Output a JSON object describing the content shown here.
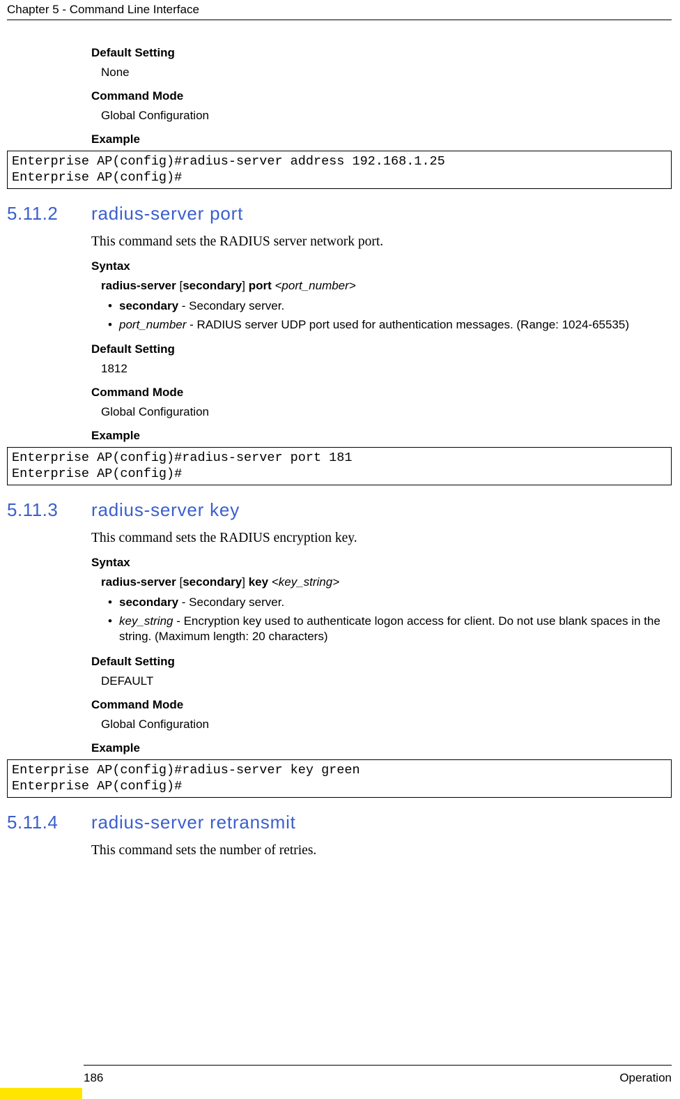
{
  "header": {
    "chapter": "Chapter 5 - Command Line Interface"
  },
  "section_5_11_1_tail": {
    "default_setting_label": "Default Setting",
    "default_setting_value": "None",
    "command_mode_label": "Command Mode",
    "command_mode_value": "Global Configuration",
    "example_label": "Example",
    "code_line1": "Enterprise AP(config)#radius-server address 192.168.1.25",
    "code_line2": "Enterprise AP(config)#"
  },
  "section_5_11_2": {
    "num": "5.11.2",
    "title": "radius-server port",
    "desc": "This command sets the RADIUS server network port.",
    "syntax_label": "Syntax",
    "syntax_cmd_b1": "radius-server",
    "syntax_open": " [",
    "syntax_cmd_b2": "secondary",
    "syntax_close": "] ",
    "syntax_cmd_b3": "port",
    "syntax_space": " ",
    "syntax_arg_open": "<",
    "syntax_arg": "port_number",
    "syntax_arg_close": ">",
    "param1_b": "secondary",
    "param1_rest": " - Secondary server.",
    "param2_i": "port_number",
    "param2_rest": " - RADIUS server UDP port used for authentication messages. (Range: 1024-65535)",
    "default_setting_label": "Default Setting",
    "default_setting_value": "1812",
    "command_mode_label": "Command Mode",
    "command_mode_value": "Global Configuration",
    "example_label": "Example",
    "code_line1": "Enterprise AP(config)#radius-server port 181",
    "code_line2": "Enterprise AP(config)#"
  },
  "section_5_11_3": {
    "num": "5.11.3",
    "title": "radius-server key",
    "desc": "This command sets the RADIUS encryption key.",
    "syntax_label": "Syntax",
    "syntax_cmd_b1": "radius-server",
    "syntax_open": " [",
    "syntax_cmd_b2": "secondary",
    "syntax_close": "] ",
    "syntax_cmd_b3": "key",
    "syntax_space": " ",
    "syntax_arg_open": "<",
    "syntax_arg": "key_string",
    "syntax_arg_close": ">",
    "param1_b": "secondary",
    "param1_rest": " - Secondary server.",
    "param2_i": "key_string",
    "param2_rest": " - Encryption key used to authenticate logon access for client. Do not use blank spaces in the string. (Maximum length: 20 characters)",
    "default_setting_label": "Default Setting",
    "default_setting_value": "DEFAULT",
    "command_mode_label": "Command Mode",
    "command_mode_value": "Global Configuration",
    "example_label": "Example",
    "code_line1": "Enterprise AP(config)#radius-server key green",
    "code_line2": "Enterprise AP(config)#"
  },
  "section_5_11_4": {
    "num": "5.11.4",
    "title": "radius-server retransmit",
    "desc": "This command sets the number of retries."
  },
  "footer": {
    "page": "186",
    "label": "Operation"
  }
}
